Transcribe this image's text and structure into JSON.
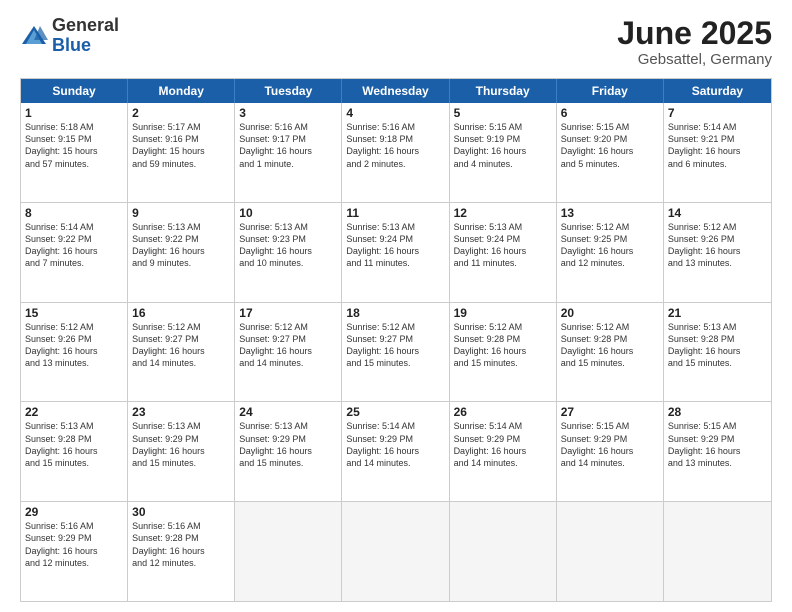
{
  "logo": {
    "general": "General",
    "blue": "Blue"
  },
  "header": {
    "month": "June 2025",
    "location": "Gebsattel, Germany"
  },
  "weekdays": [
    "Sunday",
    "Monday",
    "Tuesday",
    "Wednesday",
    "Thursday",
    "Friday",
    "Saturday"
  ],
  "weeks": [
    [
      {
        "day": "1",
        "text": "Sunrise: 5:18 AM\nSunset: 9:15 PM\nDaylight: 15 hours\nand 57 minutes."
      },
      {
        "day": "2",
        "text": "Sunrise: 5:17 AM\nSunset: 9:16 PM\nDaylight: 15 hours\nand 59 minutes."
      },
      {
        "day": "3",
        "text": "Sunrise: 5:16 AM\nSunset: 9:17 PM\nDaylight: 16 hours\nand 1 minute."
      },
      {
        "day": "4",
        "text": "Sunrise: 5:16 AM\nSunset: 9:18 PM\nDaylight: 16 hours\nand 2 minutes."
      },
      {
        "day": "5",
        "text": "Sunrise: 5:15 AM\nSunset: 9:19 PM\nDaylight: 16 hours\nand 4 minutes."
      },
      {
        "day": "6",
        "text": "Sunrise: 5:15 AM\nSunset: 9:20 PM\nDaylight: 16 hours\nand 5 minutes."
      },
      {
        "day": "7",
        "text": "Sunrise: 5:14 AM\nSunset: 9:21 PM\nDaylight: 16 hours\nand 6 minutes."
      }
    ],
    [
      {
        "day": "8",
        "text": "Sunrise: 5:14 AM\nSunset: 9:22 PM\nDaylight: 16 hours\nand 7 minutes."
      },
      {
        "day": "9",
        "text": "Sunrise: 5:13 AM\nSunset: 9:22 PM\nDaylight: 16 hours\nand 9 minutes."
      },
      {
        "day": "10",
        "text": "Sunrise: 5:13 AM\nSunset: 9:23 PM\nDaylight: 16 hours\nand 10 minutes."
      },
      {
        "day": "11",
        "text": "Sunrise: 5:13 AM\nSunset: 9:24 PM\nDaylight: 16 hours\nand 11 minutes."
      },
      {
        "day": "12",
        "text": "Sunrise: 5:13 AM\nSunset: 9:24 PM\nDaylight: 16 hours\nand 11 minutes."
      },
      {
        "day": "13",
        "text": "Sunrise: 5:12 AM\nSunset: 9:25 PM\nDaylight: 16 hours\nand 12 minutes."
      },
      {
        "day": "14",
        "text": "Sunrise: 5:12 AM\nSunset: 9:26 PM\nDaylight: 16 hours\nand 13 minutes."
      }
    ],
    [
      {
        "day": "15",
        "text": "Sunrise: 5:12 AM\nSunset: 9:26 PM\nDaylight: 16 hours\nand 13 minutes."
      },
      {
        "day": "16",
        "text": "Sunrise: 5:12 AM\nSunset: 9:27 PM\nDaylight: 16 hours\nand 14 minutes."
      },
      {
        "day": "17",
        "text": "Sunrise: 5:12 AM\nSunset: 9:27 PM\nDaylight: 16 hours\nand 14 minutes."
      },
      {
        "day": "18",
        "text": "Sunrise: 5:12 AM\nSunset: 9:27 PM\nDaylight: 16 hours\nand 15 minutes."
      },
      {
        "day": "19",
        "text": "Sunrise: 5:12 AM\nSunset: 9:28 PM\nDaylight: 16 hours\nand 15 minutes."
      },
      {
        "day": "20",
        "text": "Sunrise: 5:12 AM\nSunset: 9:28 PM\nDaylight: 16 hours\nand 15 minutes."
      },
      {
        "day": "21",
        "text": "Sunrise: 5:13 AM\nSunset: 9:28 PM\nDaylight: 16 hours\nand 15 minutes."
      }
    ],
    [
      {
        "day": "22",
        "text": "Sunrise: 5:13 AM\nSunset: 9:28 PM\nDaylight: 16 hours\nand 15 minutes."
      },
      {
        "day": "23",
        "text": "Sunrise: 5:13 AM\nSunset: 9:29 PM\nDaylight: 16 hours\nand 15 minutes."
      },
      {
        "day": "24",
        "text": "Sunrise: 5:13 AM\nSunset: 9:29 PM\nDaylight: 16 hours\nand 15 minutes."
      },
      {
        "day": "25",
        "text": "Sunrise: 5:14 AM\nSunset: 9:29 PM\nDaylight: 16 hours\nand 14 minutes."
      },
      {
        "day": "26",
        "text": "Sunrise: 5:14 AM\nSunset: 9:29 PM\nDaylight: 16 hours\nand 14 minutes."
      },
      {
        "day": "27",
        "text": "Sunrise: 5:15 AM\nSunset: 9:29 PM\nDaylight: 16 hours\nand 14 minutes."
      },
      {
        "day": "28",
        "text": "Sunrise: 5:15 AM\nSunset: 9:29 PM\nDaylight: 16 hours\nand 13 minutes."
      }
    ],
    [
      {
        "day": "29",
        "text": "Sunrise: 5:16 AM\nSunset: 9:29 PM\nDaylight: 16 hours\nand 12 minutes."
      },
      {
        "day": "30",
        "text": "Sunrise: 5:16 AM\nSunset: 9:28 PM\nDaylight: 16 hours\nand 12 minutes."
      },
      {
        "day": "",
        "text": ""
      },
      {
        "day": "",
        "text": ""
      },
      {
        "day": "",
        "text": ""
      },
      {
        "day": "",
        "text": ""
      },
      {
        "day": "",
        "text": ""
      }
    ]
  ]
}
